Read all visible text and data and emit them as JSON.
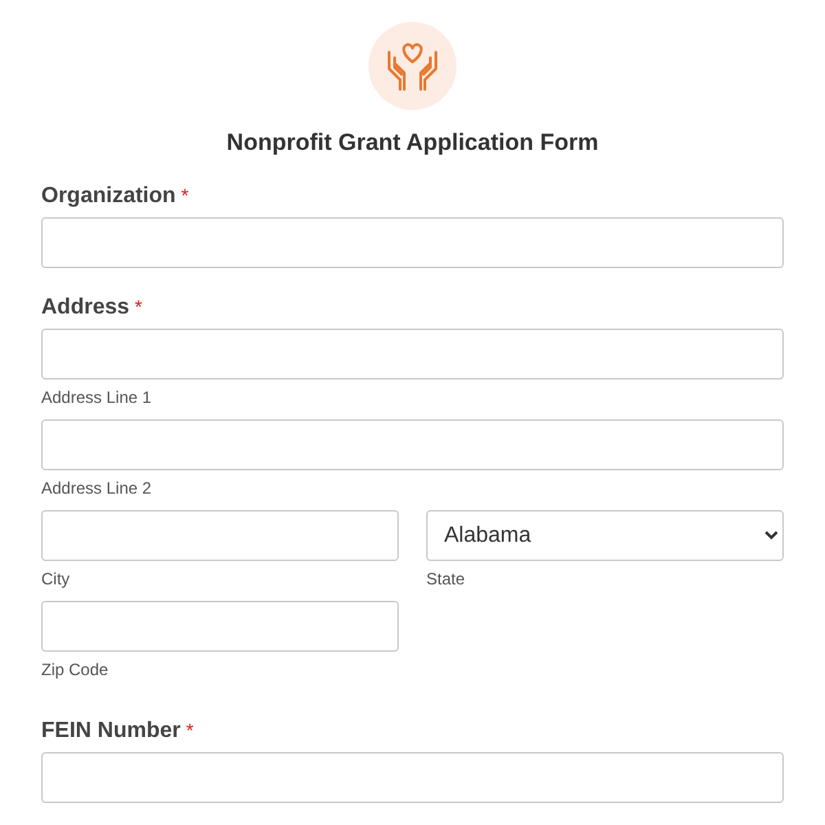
{
  "title": "Nonprofit Grant Application Form",
  "fields": [
    {
      "kind": "text",
      "label": "Organization",
      "required_mark": "*"
    },
    {
      "kind": "address",
      "label": "Address",
      "required_mark": "*",
      "line1": {
        "sublabel": "Address Line 1"
      },
      "line2": {
        "sublabel": "Address Line 2"
      },
      "city": {
        "sublabel": "City"
      },
      "state": {
        "sublabel": "State",
        "value": "Alabama"
      },
      "zip": {
        "sublabel": "Zip Code"
      }
    },
    {
      "kind": "text",
      "label": "FEIN Number",
      "required_mark": "*"
    }
  ]
}
